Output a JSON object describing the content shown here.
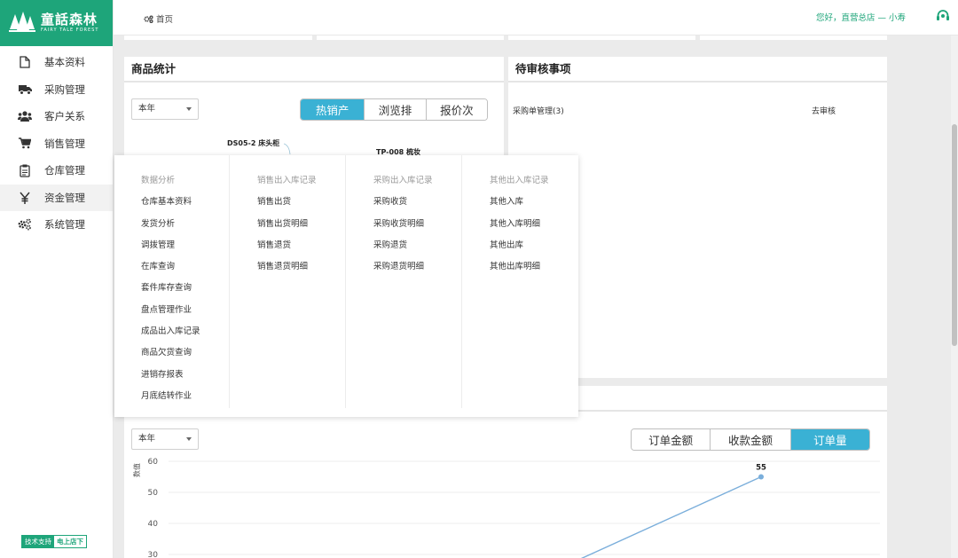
{
  "brand": {
    "name_cn": "童話森林",
    "name_en": "FAIRY TALE FOREST",
    "color": "#1ea57a"
  },
  "sidebar": {
    "items": [
      {
        "label": "基本资料",
        "icon": "document-icon"
      },
      {
        "label": "采购管理",
        "icon": "truck-icon"
      },
      {
        "label": "客户关系",
        "icon": "users-icon"
      },
      {
        "label": "销售管理",
        "icon": "cart-icon"
      },
      {
        "label": "仓库管理",
        "icon": "clipboard-icon"
      },
      {
        "label": "资金管理",
        "icon": "yen-icon"
      },
      {
        "label": "系统管理",
        "icon": "gears-icon"
      }
    ],
    "active_index": 5,
    "support_a": "技术支持",
    "support_b": "电上店下"
  },
  "topbar": {
    "breadcrumb": "首页",
    "greeting": "您好，直营总店 — 小寿"
  },
  "product_stats": {
    "title": "商品统计",
    "period": "本年",
    "tabs": [
      "热销产",
      "浏览排",
      "报价次"
    ],
    "active_tab": 0,
    "labels": [
      "DS05-2 床头柜",
      "TP-008 梳妆"
    ]
  },
  "pending": {
    "title": "待审核事项",
    "item": "采购单管理(3)",
    "action": "去审核"
  },
  "orders": {
    "period": "本年",
    "tabs": [
      "订单金额",
      "收款金额",
      "订单量"
    ],
    "active_tab": 2
  },
  "mega_menu": {
    "columns": [
      {
        "head": "数据分析",
        "links": [
          "仓库基本资料",
          "发货分析",
          "调拨管理",
          "在库查询",
          "套件库存查询",
          "盘点管理作业",
          "成品出入库记录",
          "商品欠货查询",
          "进销存报表",
          "月底结转作业"
        ]
      },
      {
        "head": "销售出入库记录",
        "links": [
          "销售出货",
          "销售出货明细",
          "销售退货",
          "销售退货明细"
        ]
      },
      {
        "head": "采购出入库记录",
        "links": [
          "采购收货",
          "采购收货明细",
          "采购退货",
          "采购退货明细"
        ]
      },
      {
        "head": "其他出入库记录",
        "links": [
          "其他入库",
          "其他入库明细",
          "其他出库",
          "其他出库明细"
        ]
      }
    ]
  },
  "chart_data": {
    "type": "line",
    "title": "",
    "ylabel": "数值",
    "yticks": [
      30,
      40,
      50,
      60
    ],
    "ylim": [
      30,
      60
    ],
    "series": [
      {
        "values": [
          55
        ],
        "point_label": "55",
        "color": "#7aaedb"
      }
    ],
    "grid": true
  },
  "colors": {
    "accent": "#3ab1d4",
    "brand": "#1ea57a"
  }
}
